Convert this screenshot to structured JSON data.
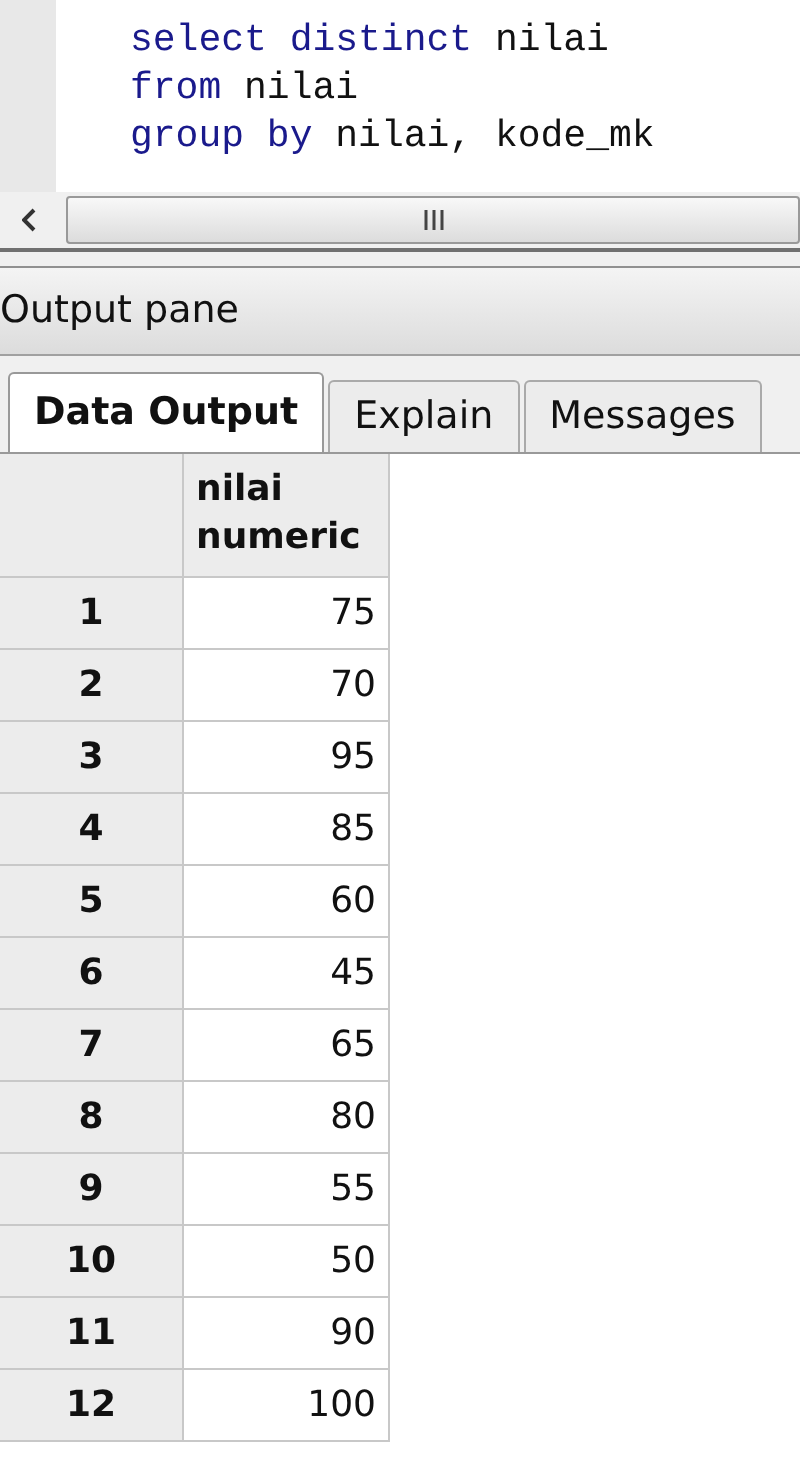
{
  "editor": {
    "lines": [
      {
        "tokens": [
          {
            "kind": "keyword",
            "text": "select"
          },
          {
            "kind": "keyword",
            "text": "distinct"
          },
          {
            "kind": "identifier",
            "text": "nilai"
          }
        ]
      },
      {
        "tokens": [
          {
            "kind": "keyword",
            "text": "from"
          },
          {
            "kind": "identifier",
            "text": "nilai"
          }
        ]
      },
      {
        "tokens": [
          {
            "kind": "keyword",
            "text": "group"
          },
          {
            "kind": "keyword",
            "text": "by"
          },
          {
            "kind": "identifier",
            "text": "nilai,"
          },
          {
            "kind": "identifier",
            "text": "kode_mk"
          }
        ]
      }
    ]
  },
  "output_pane": {
    "title": "Output pane",
    "tabs": [
      {
        "label": "Data Output",
        "selected": true
      },
      {
        "label": "Explain",
        "selected": false
      },
      {
        "label": "Messages",
        "selected": false
      }
    ],
    "table": {
      "columns": [
        {
          "name": "nilai",
          "type": "numeric"
        }
      ],
      "rows": [
        {
          "number": "1",
          "value": "75"
        },
        {
          "number": "2",
          "value": "70"
        },
        {
          "number": "3",
          "value": "95"
        },
        {
          "number": "4",
          "value": "85"
        },
        {
          "number": "5",
          "value": "60"
        },
        {
          "number": "6",
          "value": "45"
        },
        {
          "number": "7",
          "value": "65"
        },
        {
          "number": "8",
          "value": "80"
        },
        {
          "number": "9",
          "value": "55"
        },
        {
          "number": "10",
          "value": "50"
        },
        {
          "number": "11",
          "value": "90"
        },
        {
          "number": "12",
          "value": "100"
        }
      ]
    }
  }
}
